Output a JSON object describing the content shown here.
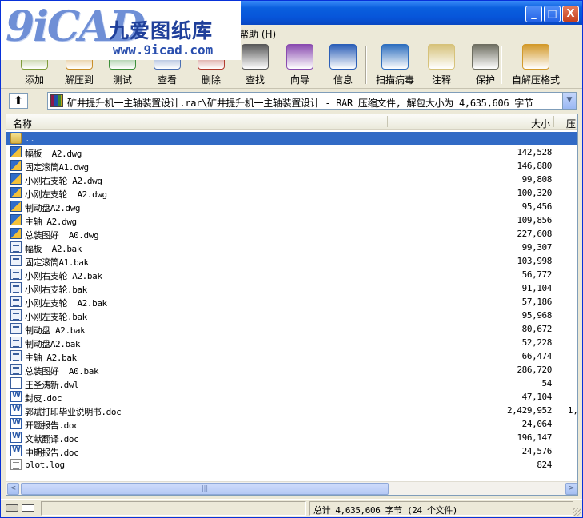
{
  "logo": {
    "mark": "9iCAD",
    "brand_cn": "九爱图纸库",
    "url": "www.9icad.com"
  },
  "window_buttons": {
    "minimize": "_",
    "maximize": "□",
    "close": "X"
  },
  "menu": {
    "help_label": "帮助 (H)"
  },
  "toolbar": [
    {
      "label": "添加",
      "icon": "add-icon",
      "color": "#7e9c3a"
    },
    {
      "label": "解压到",
      "icon": "extract-to-icon",
      "color": "#c98f2a"
    },
    {
      "label": "测试",
      "icon": "test-icon",
      "color": "#3d8f3a"
    },
    {
      "label": "查看",
      "icon": "view-icon",
      "color": "#4a6fb3"
    },
    {
      "label": "删除",
      "icon": "delete-icon",
      "color": "#b13b2e"
    },
    {
      "label": "查找",
      "icon": "find-icon",
      "color": "#5a5a5a"
    },
    {
      "label": "向导",
      "icon": "wizard-icon",
      "color": "#8a4bb0"
    },
    {
      "label": "信息",
      "icon": "info-icon",
      "color": "#2c5fb8"
    },
    {
      "label": "扫描病毒",
      "icon": "virus-scan-icon",
      "color": "#2f6fbf"
    },
    {
      "label": "注释",
      "icon": "comment-icon",
      "color": "#d6c27a"
    },
    {
      "label": "保护",
      "icon": "protect-icon",
      "color": "#6f6f62"
    },
    {
      "label": "自解压格式",
      "icon": "sfx-icon",
      "color": "#d39a2b"
    }
  ],
  "address": {
    "path": "矿井提升机一主轴装置设计.rar\\矿井提升机一主轴装置设计 - RAR 压缩文件, 解包大小为 4,635,606 字节",
    "up_glyph": "⬆",
    "dropdown_glyph": "▼"
  },
  "columns": {
    "name": "名称",
    "size": "大小",
    "packed": "压缩"
  },
  "files": [
    {
      "name": "..",
      "size": "",
      "packed": "",
      "type": "folder",
      "selected": true
    },
    {
      "name": "幅板  A2.dwg",
      "size": "142,528",
      "packed": "",
      "type": "dwg"
    },
    {
      "name": "固定滚筒A1.dwg",
      "size": "146,880",
      "packed": "",
      "type": "dwg"
    },
    {
      "name": "小刚右支轮 A2.dwg",
      "size": "99,808",
      "packed": "",
      "type": "dwg"
    },
    {
      "name": "小刚左支轮  A2.dwg",
      "size": "100,320",
      "packed": "",
      "type": "dwg"
    },
    {
      "name": "制动盘A2.dwg",
      "size": "95,456",
      "packed": "",
      "type": "dwg"
    },
    {
      "name": "主轴 A2.dwg",
      "size": "109,856",
      "packed": "",
      "type": "dwg"
    },
    {
      "name": "总装图好  A0.dwg",
      "size": "227,608",
      "packed": "",
      "type": "dwg"
    },
    {
      "name": "幅板  A2.bak",
      "size": "99,307",
      "packed": "",
      "type": "bak"
    },
    {
      "name": "固定滚筒A1.bak",
      "size": "103,998",
      "packed": "",
      "type": "bak"
    },
    {
      "name": "小刚右支轮 A2.bak",
      "size": "56,772",
      "packed": "",
      "type": "bak"
    },
    {
      "name": "小刚右支轮.bak",
      "size": "91,104",
      "packed": "",
      "type": "bak"
    },
    {
      "name": "小刚左支轮  A2.bak",
      "size": "57,186",
      "packed": "",
      "type": "bak"
    },
    {
      "name": "小刚左支轮.bak",
      "size": "95,968",
      "packed": "",
      "type": "bak"
    },
    {
      "name": "制动盘 A2.bak",
      "size": "80,672",
      "packed": "",
      "type": "bak"
    },
    {
      "name": "制动盘A2.bak",
      "size": "52,228",
      "packed": "",
      "type": "bak"
    },
    {
      "name": "主轴 A2.bak",
      "size": "66,474",
      "packed": "",
      "type": "bak"
    },
    {
      "name": "总装图好  A0.bak",
      "size": "286,720",
      "packed": "",
      "type": "bak"
    },
    {
      "name": "王圣涛新.dwl",
      "size": "54",
      "packed": "",
      "type": "dwl"
    },
    {
      "name": "封皮.doc",
      "size": "47,104",
      "packed": "",
      "type": "doc"
    },
    {
      "name": "郭斌打印毕业说明书.doc",
      "size": "2,429,952",
      "packed": "1,",
      "type": "doc"
    },
    {
      "name": "开题报告.doc",
      "size": "24,064",
      "packed": "",
      "type": "doc"
    },
    {
      "name": "文献翻译.doc",
      "size": "196,147",
      "packed": "",
      "type": "doc"
    },
    {
      "name": "中期报告.doc",
      "size": "24,576",
      "packed": "",
      "type": "doc"
    },
    {
      "name": "plot.log",
      "size": "824",
      "packed": "",
      "type": "log"
    }
  ],
  "scroll": {
    "left": "<",
    "right": ">",
    "thumb": "|||"
  },
  "status": {
    "total": "总计 4,635,606 字节 (24 个文件)"
  },
  "colors": {
    "selection": "#316ac5",
    "titlebar": "#0755d9"
  }
}
